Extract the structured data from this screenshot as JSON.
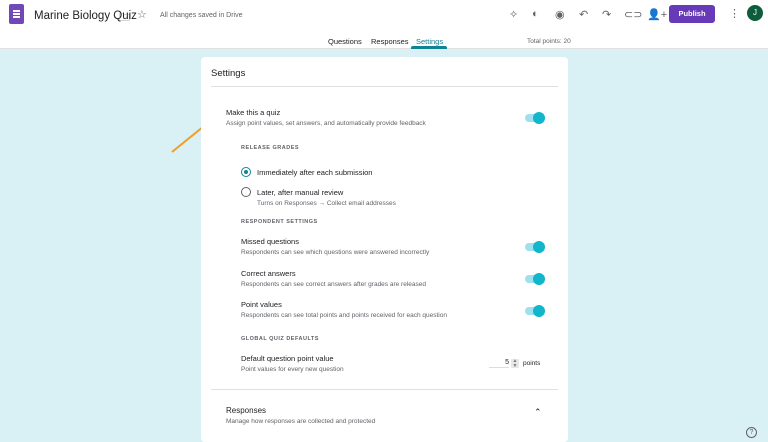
{
  "header": {
    "title": "Marine Biology Quiz",
    "saved_status": "All changes saved in Drive",
    "publish_label": "Publish",
    "avatar_initial": "J"
  },
  "tabs": [
    {
      "label": "Questions"
    },
    {
      "label": "Responses"
    },
    {
      "label": "Settings",
      "active": true
    }
  ],
  "total_points": "Total points: 20",
  "settings": {
    "title": "Settings",
    "quiz": {
      "label": "Make this a quiz",
      "description": "Assign point values, set answers, and automatically provide feedback",
      "enabled": true
    },
    "release_grades": {
      "caption": "RELEASE GRADES",
      "options": [
        {
          "label": "Immediately after each submission",
          "selected": true
        },
        {
          "label": "Later, after manual review",
          "hint": "Turns on Responses → Collect email addresses",
          "selected": false
        }
      ]
    },
    "respondent_settings": {
      "caption": "RESPONDENT SETTINGS",
      "items": [
        {
          "label": "Missed questions",
          "description": "Respondents can see which questions were answered incorrectly",
          "enabled": true
        },
        {
          "label": "Correct answers",
          "description": "Respondents can see correct answers after grades are released",
          "enabled": true
        },
        {
          "label": "Point values",
          "description": "Respondents can see total points and points received for each question",
          "enabled": true
        }
      ]
    },
    "global_defaults": {
      "caption": "GLOBAL QUIZ DEFAULTS",
      "label": "Default question point value",
      "description": "Point values for every new question",
      "value": "5",
      "unit": "points"
    },
    "responses": {
      "label": "Responses",
      "description": "Manage how responses are collected and protected"
    }
  },
  "colors": {
    "accent": "#12b5cb",
    "brand": "#673ab7",
    "arrow": "#f29d25",
    "background": "#d9f0f4"
  }
}
